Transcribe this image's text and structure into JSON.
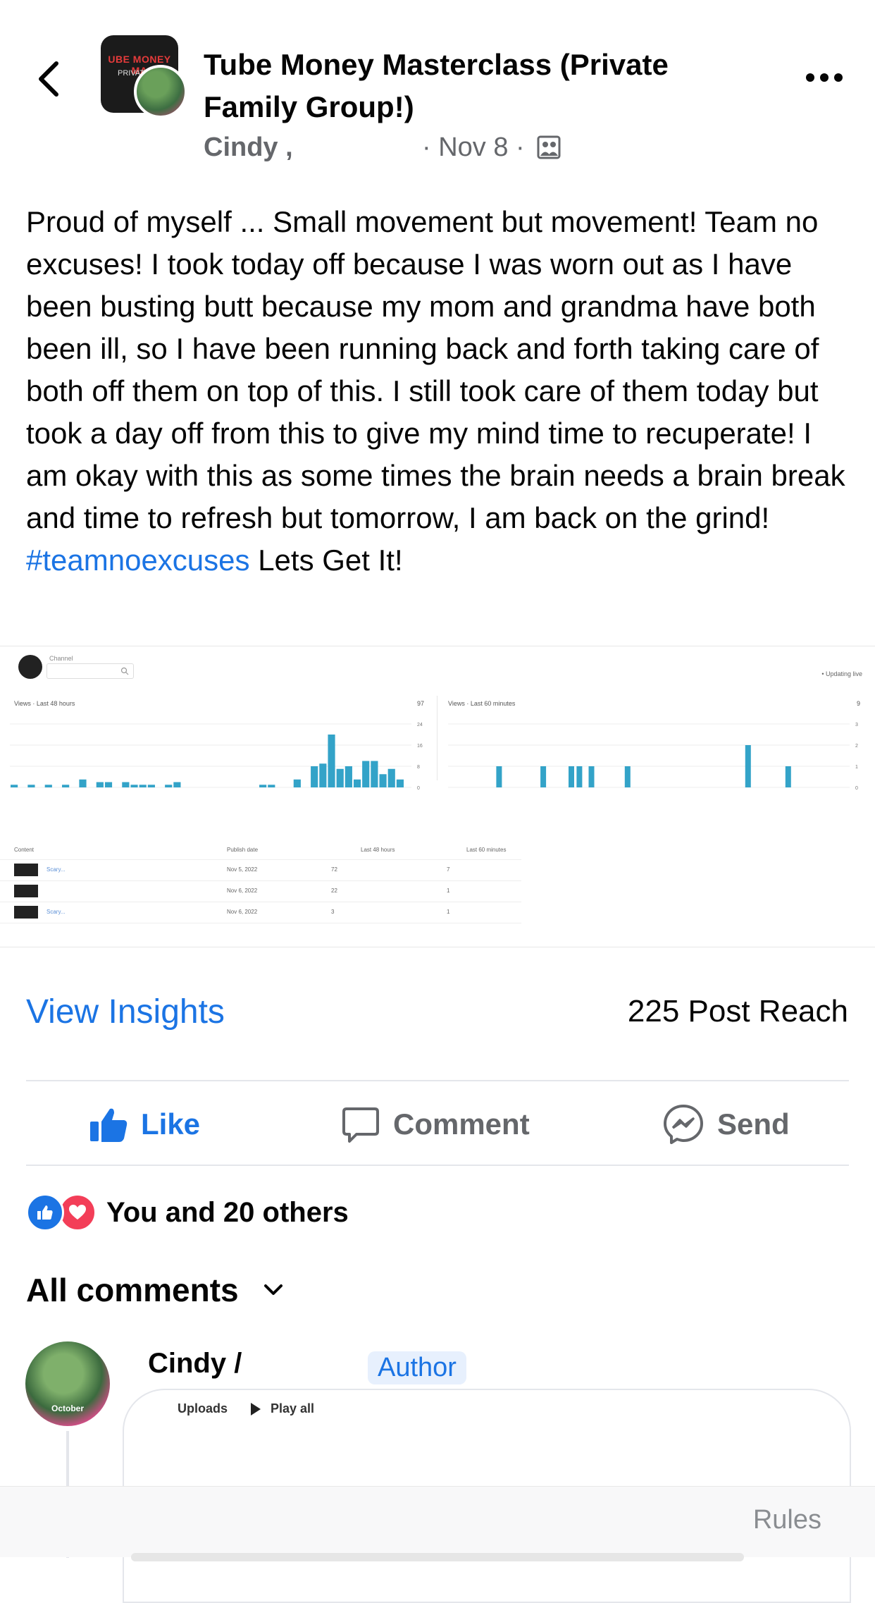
{
  "header": {
    "group_name": "Tube Money Masterclass (Private Family Group!)",
    "group_avatar_text_1": "UBE MONEY MA",
    "group_avatar_text_2": "PRIVATE FA",
    "author": "Cindy ,",
    "date": "· Nov 8 ·"
  },
  "post": {
    "text": "Proud of myself ... Small movement but movement! Team no excuses! I took today off because I was worn out as I have been busting butt because my mom and grandma have both been ill, so I have been running back and forth taking care of both off them on top of this. I still took care of them today but took a day off from this to give my mind time to recuperate! I am okay with this as some times the brain needs a brain break and time to refresh but tomorrow, I am back on the grind!",
    "hashtag": "#teamnoexcuses",
    "tail": " Lets Get It!"
  },
  "screenshot": {
    "channel_label": "Channel",
    "updating": "• Updating live",
    "left_title": "Views · Last 48 hours",
    "left_total": "97",
    "right_title": "Views · Last 60 minutes",
    "right_total": "9",
    "left_ticks": [
      "24",
      "16",
      "8",
      "0"
    ],
    "right_ticks": [
      "3",
      "2",
      "1",
      "0"
    ],
    "left_bars": [
      1,
      0,
      1,
      0,
      1,
      0,
      1,
      0,
      3,
      0,
      2,
      2,
      0,
      2,
      1,
      1,
      1,
      0,
      1,
      2,
      0,
      0,
      0,
      0,
      0,
      0,
      0,
      0,
      0,
      1,
      1,
      0,
      0,
      3,
      0,
      8,
      9,
      20,
      7,
      8,
      3,
      10,
      10,
      5,
      7,
      3
    ],
    "right_bars_positions": [
      0.12,
      0.23,
      0.3,
      0.32,
      0.35,
      0.44,
      0.74,
      0.84
    ],
    "right_bars_values": [
      1,
      1,
      1,
      1,
      1,
      1,
      2,
      1
    ],
    "table": {
      "headers": [
        "Content",
        "Publish date",
        "Last 48 hours",
        "Last 60 minutes"
      ],
      "rows": [
        {
          "title": "Scary...",
          "date": "Nov 5, 2022",
          "h48": "72",
          "m60": "7"
        },
        {
          "title": "",
          "date": "Nov 6, 2022",
          "h48": "22",
          "m60": "1"
        },
        {
          "title": "Scary...",
          "date": "Nov 6, 2022",
          "h48": "3",
          "m60": "1"
        }
      ]
    }
  },
  "insights": {
    "view_label": "View Insights",
    "reach": "225 Post Reach"
  },
  "actions": {
    "like": "Like",
    "comment": "Comment",
    "send": "Send"
  },
  "reactions": {
    "text": "You and 20 others"
  },
  "comments": {
    "sort_label": "All comments",
    "first": {
      "name": "Cindy /",
      "badge": "Author",
      "avatar_tag": "October",
      "card_uploads": "Uploads",
      "card_playall": "Play all"
    }
  },
  "bottom": {
    "rules": "Rules"
  },
  "colors": {
    "accent": "#1b74e4",
    "secondary_text": "#65676b",
    "bar": "#33a3c8"
  }
}
